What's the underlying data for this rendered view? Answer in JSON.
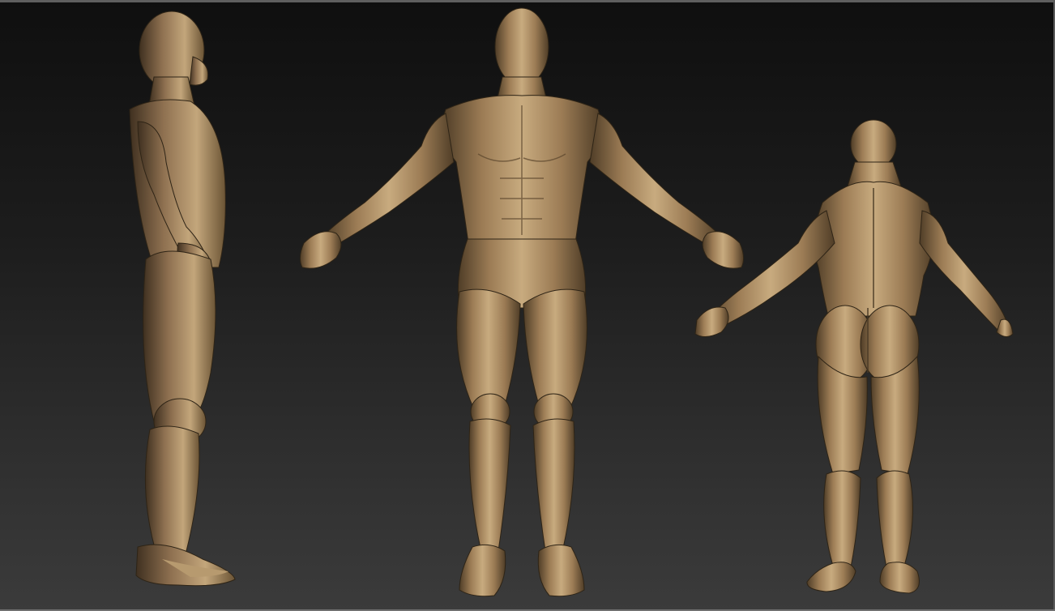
{
  "viewport": {
    "background_top": "#0f0f0f",
    "background_bottom": "#3b3b3b"
  },
  "colors": {
    "skin_light": "#c9ac80",
    "skin_mid": "#a8875d",
    "skin_dark": "#5f4a30",
    "skin_shadow": "#3a2d1c"
  },
  "views": [
    {
      "id": "side",
      "description_icon": "human-figure-side-icon"
    },
    {
      "id": "front",
      "description_icon": "human-figure-front-icon"
    },
    {
      "id": "back",
      "description_icon": "human-figure-back-icon"
    }
  ]
}
